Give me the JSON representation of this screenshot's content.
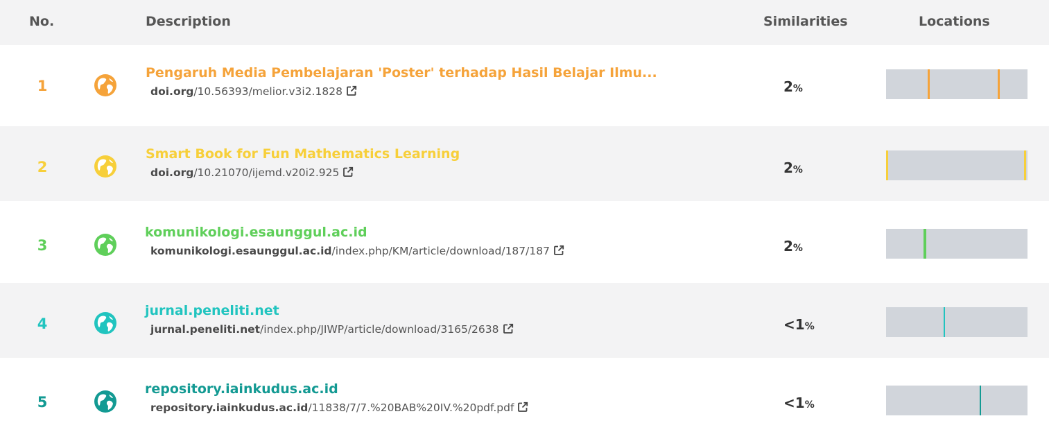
{
  "header": {
    "no": "No.",
    "description": "Description",
    "similarities": "Similarities",
    "locations": "Locations"
  },
  "rows": [
    {
      "no": "1",
      "title": "Pengaruh Media Pembelajaran 'Poster' terhadap Hasil Belajar Ilmu...",
      "url_host": "doi.org",
      "url_path": "/10.56393/melior.v3i2.1828",
      "similarity": "2",
      "pct": "%",
      "color": "#f5a33a",
      "locations": [
        0.3,
        0.8
      ],
      "icons": [
        "globe-icon",
        "external-link-icon"
      ]
    },
    {
      "no": "2",
      "title": "Smart Book for Fun Mathematics Learning",
      "url_host": "doi.org",
      "url_path": "/10.21070/ijemd.v20i2.925",
      "similarity": "2",
      "pct": "%",
      "color": "#f7cf3a",
      "locations": [
        0.0,
        0.99
      ],
      "icons": [
        "globe-icon",
        "external-link-icon"
      ]
    },
    {
      "no": "3",
      "title": "komunikologi.esaunggul.ac.id",
      "url_host": "komunikologi.esaunggul.ac.id",
      "url_path": "/index.php/KM/article/download/187/187",
      "similarity": "2",
      "pct": "%",
      "color": "#5fcf5a",
      "locations": [
        0.27
      ],
      "icons": [
        "globe-icon",
        "external-link-icon"
      ]
    },
    {
      "no": "4",
      "title": "jurnal.peneliti.net",
      "url_host": "jurnal.peneliti.net",
      "url_path": "/index.php/JIWP/article/download/3165/2638",
      "similarity": "<1",
      "pct": "%",
      "color": "#21c4bf",
      "locations": [
        0.41
      ],
      "icons": [
        "globe-icon",
        "external-link-icon"
      ]
    },
    {
      "no": "5",
      "title": "repository.iainkudus.ac.id",
      "url_host": "repository.iainkudus.ac.id",
      "url_path": "/11838/7/7.%20BAB%20IV.%20pdf.pdf",
      "similarity": "<1",
      "pct": "%",
      "color": "#139a93",
      "locations": [
        0.67
      ],
      "icons": [
        "globe-icon",
        "external-link-icon"
      ]
    }
  ]
}
